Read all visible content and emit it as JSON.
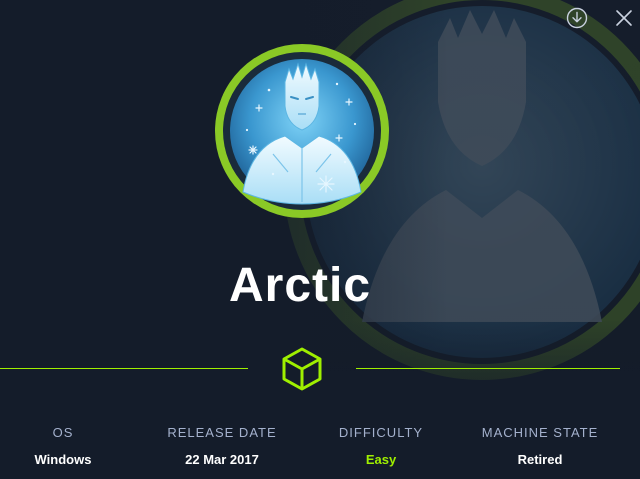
{
  "machine": {
    "name": "Arctic"
  },
  "actions": {
    "download_icon": "download-icon",
    "close_icon": "close-icon"
  },
  "stats": [
    {
      "label": "OS",
      "value": "Windows"
    },
    {
      "label": "RELEASE DATE",
      "value": "22 Mar 2017"
    },
    {
      "label": "DIFFICULTY",
      "value": "Easy"
    },
    {
      "label": "MACHINE STATE",
      "value": "Retired"
    }
  ],
  "colors": {
    "background": "#141c2a",
    "accent": "#9fef00",
    "label": "#a4b1cd",
    "value": "#ffffff",
    "avatar_ring": "#8ac926"
  }
}
